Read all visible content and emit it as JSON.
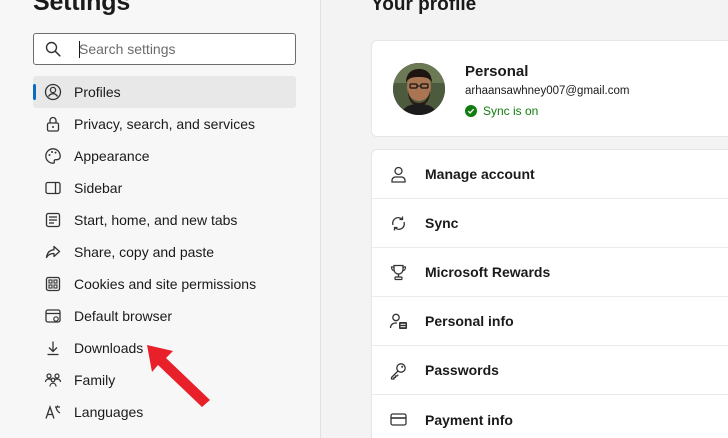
{
  "sidebar": {
    "title": "Settings",
    "search": {
      "placeholder": "Search settings",
      "value": ""
    },
    "items": [
      {
        "label": "Profiles",
        "icon": "profile-icon",
        "active": true
      },
      {
        "label": "Privacy, search, and services",
        "icon": "lock-icon"
      },
      {
        "label": "Appearance",
        "icon": "palette-icon"
      },
      {
        "label": "Sidebar",
        "icon": "sidebar-icon"
      },
      {
        "label": "Start, home, and new tabs",
        "icon": "home-tabs-icon"
      },
      {
        "label": "Share, copy and paste",
        "icon": "share-icon"
      },
      {
        "label": "Cookies and site permissions",
        "icon": "cookie-icon"
      },
      {
        "label": "Default browser",
        "icon": "browser-icon"
      },
      {
        "label": "Downloads",
        "icon": "download-icon"
      },
      {
        "label": "Family",
        "icon": "family-icon"
      },
      {
        "label": "Languages",
        "icon": "languages-icon"
      }
    ]
  },
  "main": {
    "title": "Your profile",
    "profile": {
      "name": "Personal",
      "email": "arhaansawhney007@gmail.com",
      "sync": "Sync is on"
    },
    "menu": [
      {
        "label": "Manage account",
        "icon": "person-icon"
      },
      {
        "label": "Sync",
        "icon": "sync-icon"
      },
      {
        "label": "Microsoft Rewards",
        "icon": "trophy-icon"
      },
      {
        "label": "Personal info",
        "icon": "personal-info-icon"
      },
      {
        "label": "Passwords",
        "icon": "key-icon"
      },
      {
        "label": "Payment info",
        "icon": "credit-card-icon"
      }
    ]
  },
  "colors": {
    "accent": "#0f6cbd",
    "sync_green": "#107c10",
    "annotation_arrow": "#e8202a"
  }
}
